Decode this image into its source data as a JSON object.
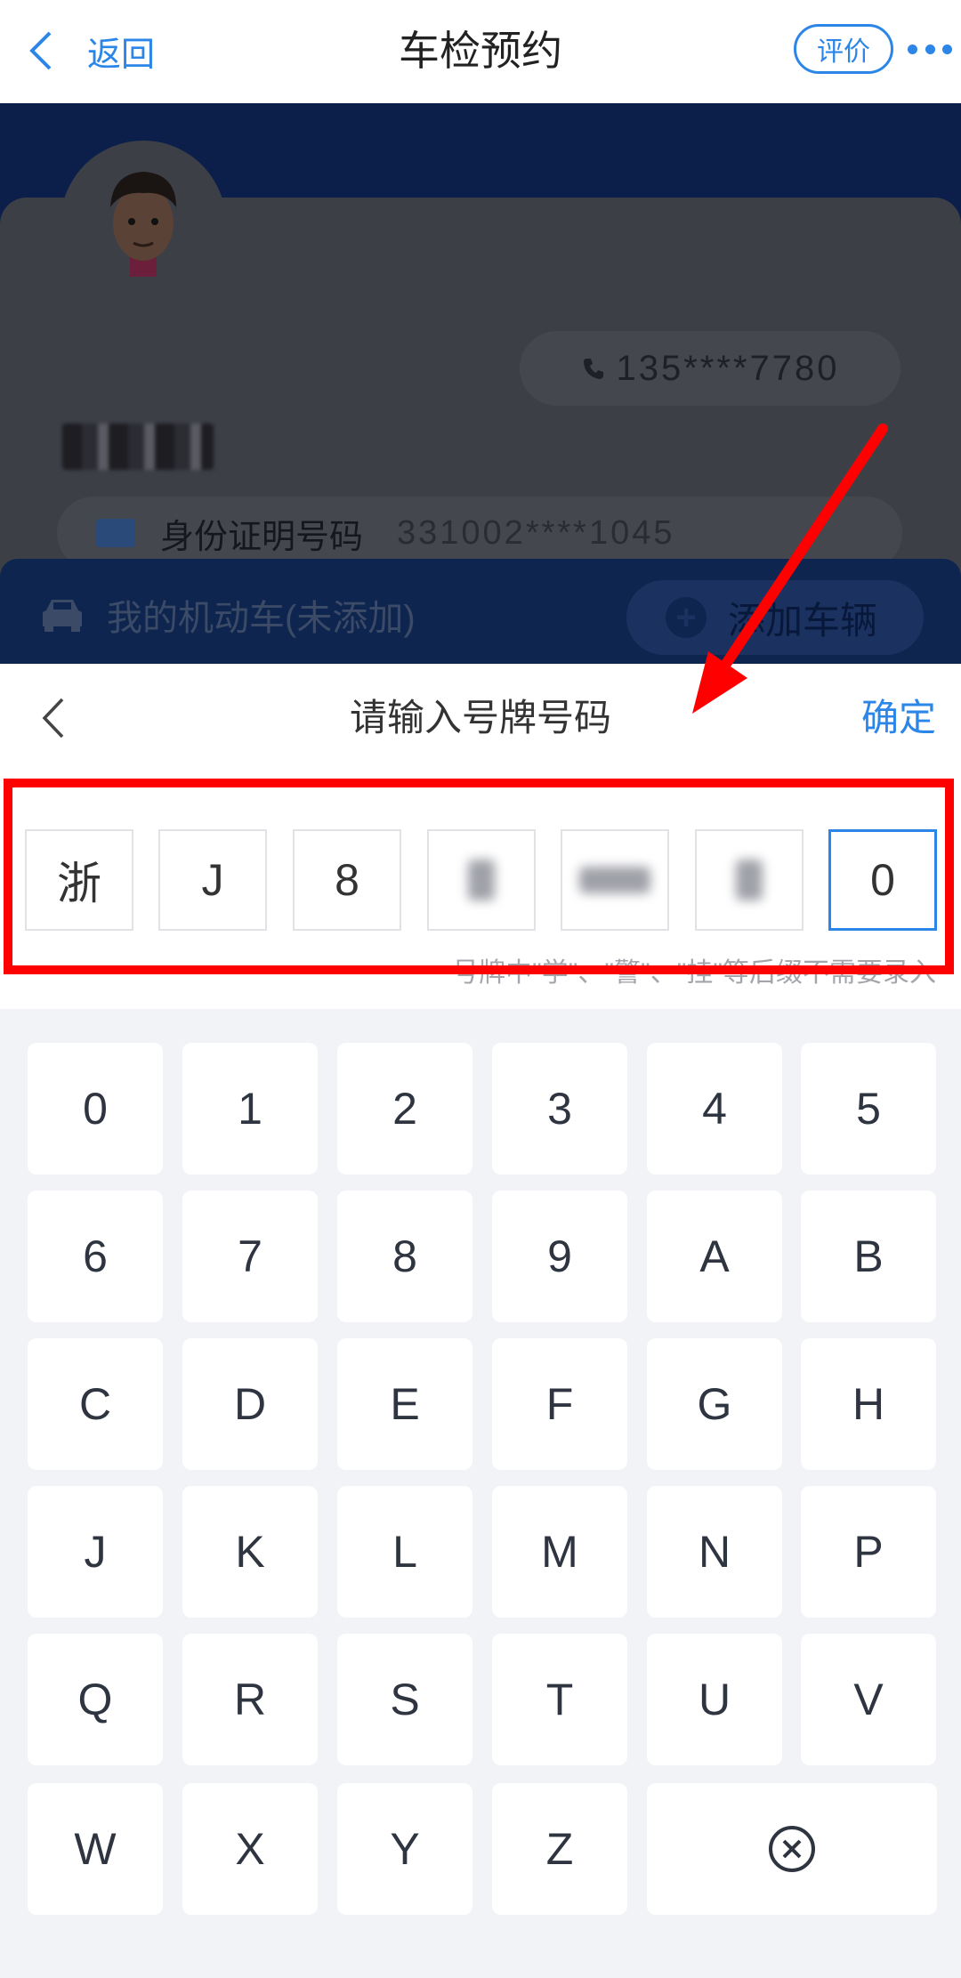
{
  "nav": {
    "back_label": "返回",
    "title": "车检预约",
    "rate_label": "评价"
  },
  "profile": {
    "phone": "135****7780",
    "id_label": "身份证明号码",
    "id_value": "331002****1045",
    "vehicle_label": "我的机动车(未添加)",
    "add_vehicle_label": "添加车辆",
    "add_vehicle_icon": "plus-circle-icon"
  },
  "plate_panel": {
    "title": "请输入号牌号码",
    "confirm_label": "确定",
    "hint": "号牌中\"学\"、\"警\"、\"挂\"等后缀不需要录入",
    "chars": [
      "浙",
      "J",
      "8",
      "",
      "",
      "",
      "0"
    ],
    "active_index": 6
  },
  "keyboard": {
    "keys": [
      "0",
      "1",
      "2",
      "3",
      "4",
      "5",
      "6",
      "7",
      "8",
      "9",
      "A",
      "B",
      "C",
      "D",
      "E",
      "F",
      "G",
      "H",
      "J",
      "K",
      "L",
      "M",
      "N",
      "P",
      "Q",
      "R",
      "S",
      "T",
      "U",
      "V",
      "W",
      "X",
      "Y",
      "Z"
    ],
    "delete_icon": "delete-circle-x-icon"
  },
  "colors": {
    "accent": "#2b86e8",
    "highlight": "#ff0000"
  }
}
